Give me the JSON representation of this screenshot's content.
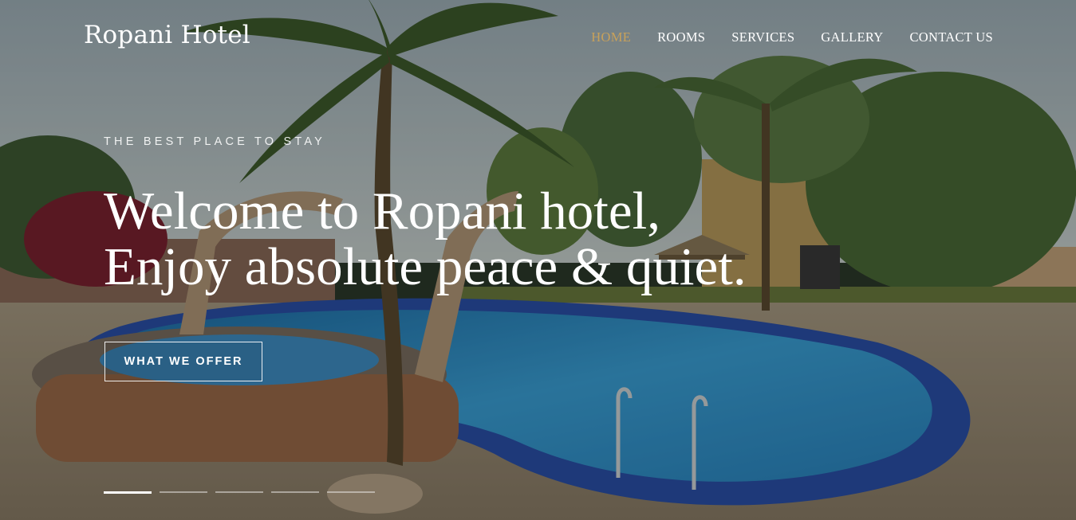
{
  "brand": {
    "name": "Ropani Hotel"
  },
  "nav": {
    "items": [
      {
        "label": "HOME",
        "active": true
      },
      {
        "label": "ROOMS",
        "active": false
      },
      {
        "label": "SERVICES",
        "active": false
      },
      {
        "label": "GALLERY",
        "active": false
      },
      {
        "label": "CONTACT US",
        "active": false
      }
    ]
  },
  "hero": {
    "tagline": "THE BEST PLACE TO STAY",
    "headline_line1": "Welcome to Ropani hotel,",
    "headline_line2": "Enjoy absolute peace & quiet.",
    "cta_label": "WHAT WE OFFER"
  },
  "slider": {
    "slide_count": 5,
    "active_index": 0
  },
  "colors": {
    "accent": "#c8a15a",
    "text": "#ffffff",
    "pool_water": "#2f8fc4",
    "pool_tile": "#2a4fa8"
  },
  "background": {
    "scene": "pool-with-palm-trees-image"
  }
}
